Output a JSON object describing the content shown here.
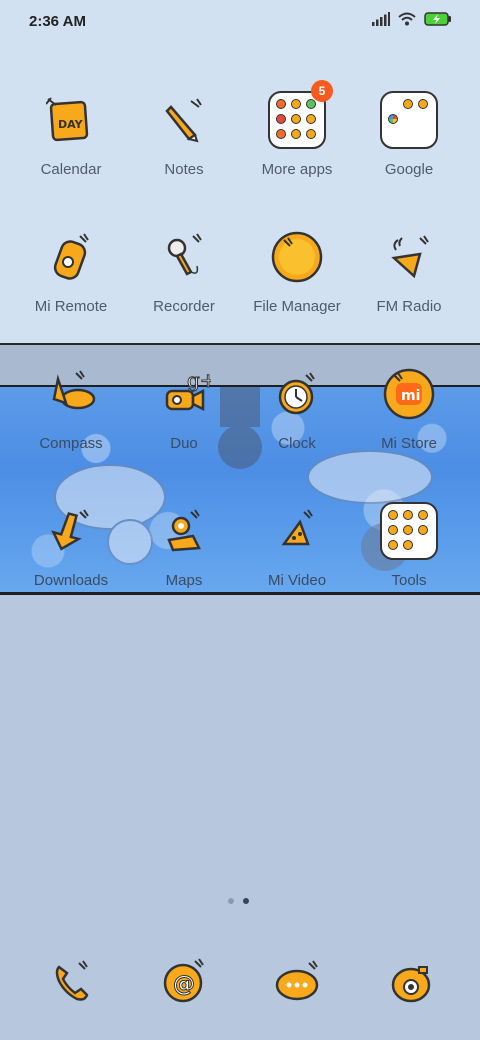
{
  "status": {
    "time": "2:36 AM"
  },
  "apps": {
    "calendar": "Calendar",
    "calendar_day": "DAY",
    "notes": "Notes",
    "more_apps": "More apps",
    "more_apps_badge": "5",
    "google": "Google",
    "mi_remote": "Mi Remote",
    "recorder": "Recorder",
    "file_manager": "File Manager",
    "fm_radio": "FM Radio",
    "compass": "Compass",
    "duo": "Duo",
    "clock": "Clock",
    "mi_store": "Mi Store",
    "mi_store_logo": "mi",
    "downloads": "Downloads",
    "maps": "Maps",
    "mi_video": "Mi Video",
    "tools": "Tools"
  },
  "page_indicator": {
    "count": 2,
    "active_index": 1
  },
  "dock": [
    "phone-icon",
    "email-icon",
    "messages-icon",
    "camera-icon"
  ],
  "colors": {
    "accent": "#f7a81b",
    "badge": "#f55a1f",
    "top_bg": "#d2e1f2",
    "water": "#4c8ee5"
  }
}
